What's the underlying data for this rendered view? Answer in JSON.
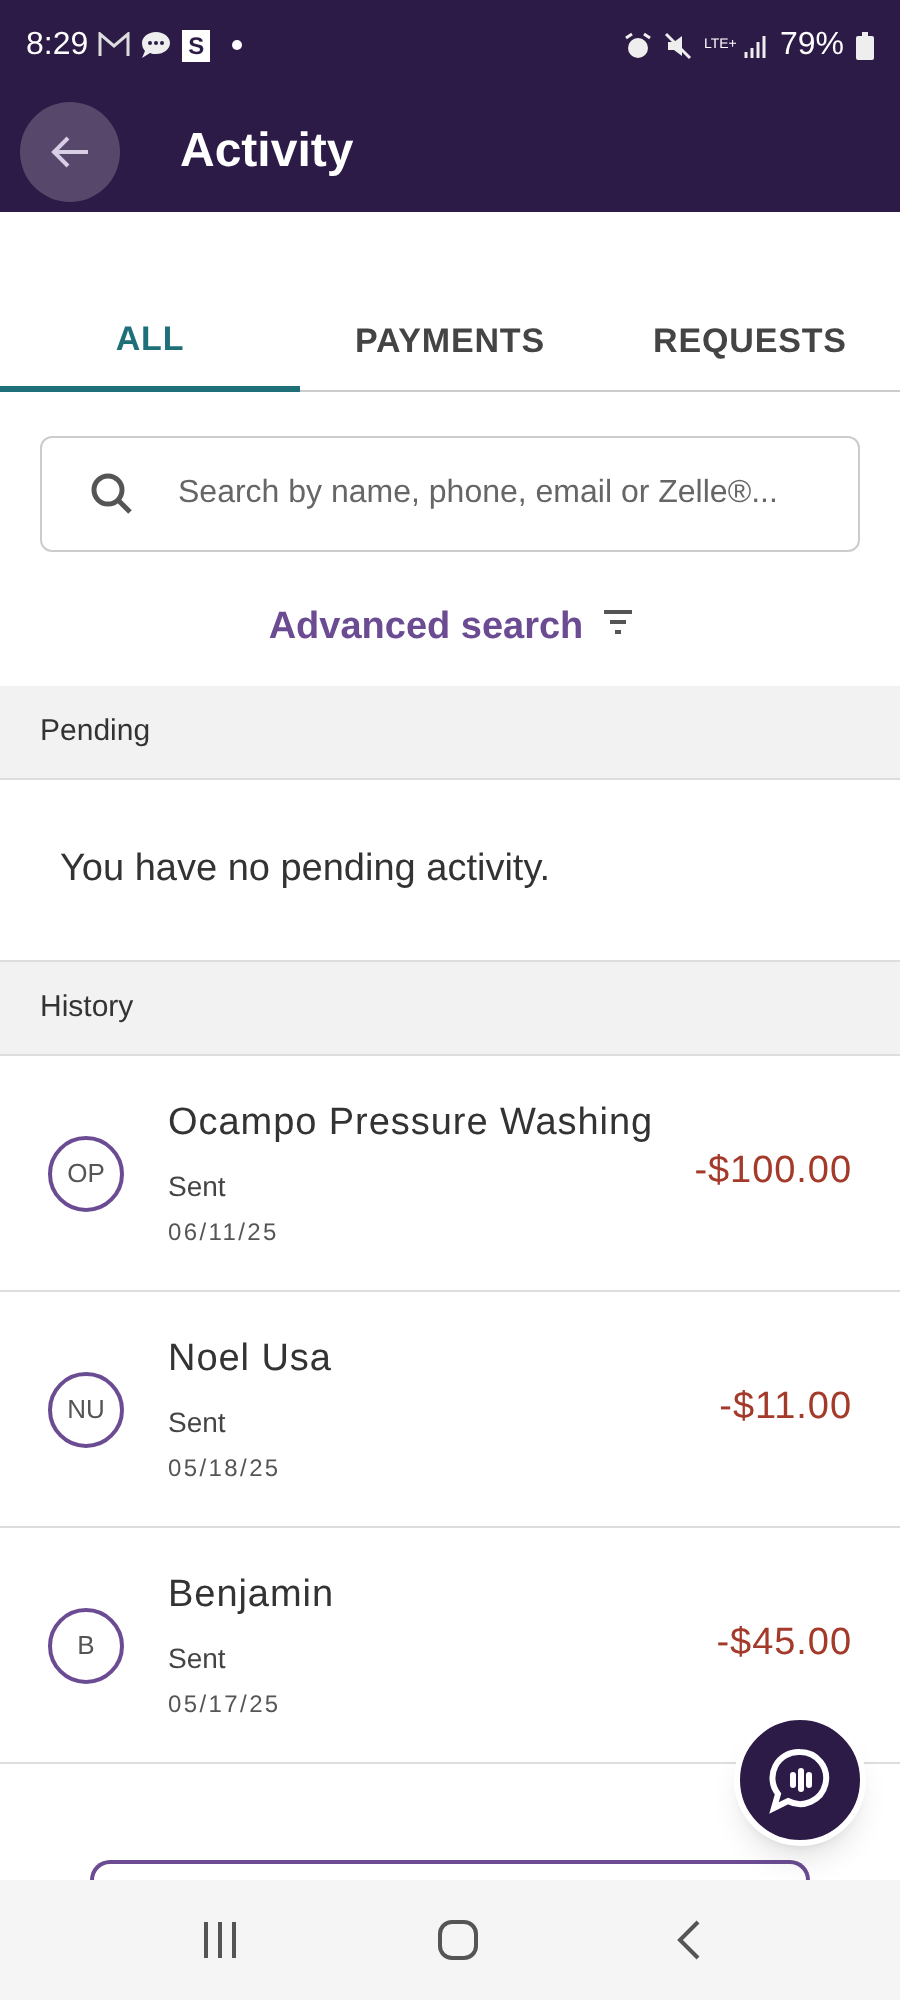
{
  "status_bar": {
    "time": "8:29",
    "app_badge": "S",
    "network": "LTE+",
    "battery": "79%"
  },
  "header": {
    "title": "Activity"
  },
  "tabs": [
    {
      "label": "ALL",
      "selected": true
    },
    {
      "label": "PAYMENTS",
      "selected": false
    },
    {
      "label": "REQUESTS",
      "selected": false
    }
  ],
  "search": {
    "placeholder": "Search by name, phone, email or Zelle®..."
  },
  "advanced_search": "Advanced search",
  "pending": {
    "heading": "Pending",
    "message": "You have no pending activity."
  },
  "history": {
    "heading": "History",
    "items": [
      {
        "initials": "OP",
        "name": "Ocampo Pressure Washing",
        "status": "Sent",
        "date": "06/11/25",
        "amount": "-$100.00"
      },
      {
        "initials": "NU",
        "name": "Noel Usa",
        "status": "Sent",
        "date": "05/18/25",
        "amount": "-$11.00"
      },
      {
        "initials": "B",
        "name": "Benjamin",
        "status": "Sent",
        "date": "05/17/25",
        "amount": "-$45.00"
      }
    ]
  }
}
